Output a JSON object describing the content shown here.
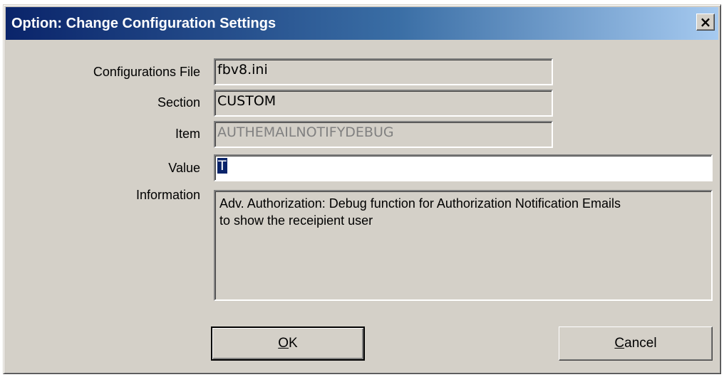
{
  "window": {
    "title": "Option: Change Configuration Settings",
    "close_label": "×"
  },
  "form": {
    "config_file": {
      "label": "Configurations File",
      "value": "fbv8.ini"
    },
    "section": {
      "label": "Section",
      "value": "CUSTOM"
    },
    "item": {
      "label": "Item",
      "value": "AUTHEMAILNOTIFYDEBUG"
    },
    "value": {
      "label": "Value",
      "value": "T"
    },
    "information": {
      "label": "Information",
      "text_line1": "Adv. Authorization: Debug function for Authorization Notification Emails",
      "text_line2": "to show the receipient user"
    }
  },
  "buttons": {
    "ok": {
      "mnemonic": "O",
      "rest": "K"
    },
    "cancel": {
      "mnemonic": "C",
      "rest": "ancel"
    }
  },
  "colors": {
    "dialog_face": "#d4d0c8",
    "title_start": "#0a246a",
    "title_end": "#a6caf0",
    "selection": "#0a246a"
  }
}
